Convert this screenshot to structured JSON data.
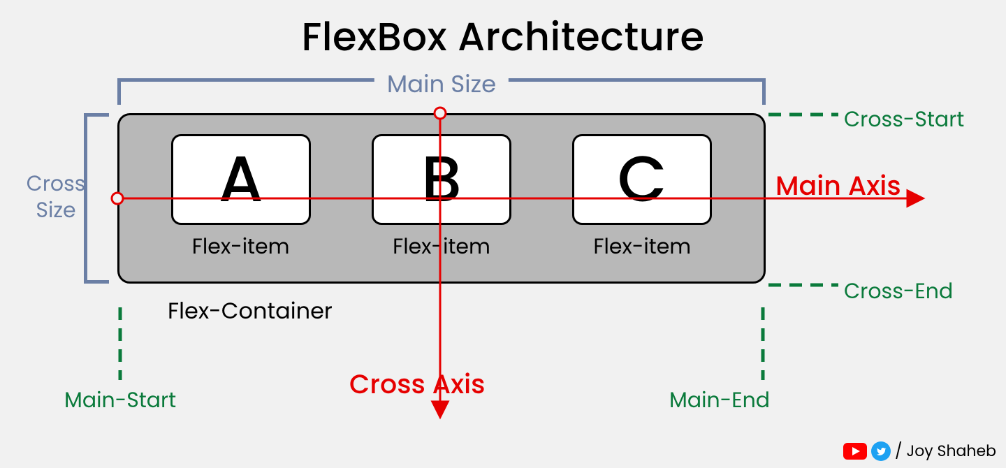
{
  "title": "FlexBox Architecture",
  "mainSizeLabel": "Main Size",
  "crossSizeLabel": "Cross\nSize",
  "items": {
    "a": "A",
    "b": "B",
    "c": "C"
  },
  "flexItemLabel": "Flex-item",
  "containerLabel": "Flex-Container",
  "axis": {
    "mainAxis": "Main Axis",
    "crossAxis": "Cross Axis"
  },
  "edges": {
    "crossStart": "Cross-Start",
    "crossEnd": "Cross-End",
    "mainStart": "Main-Start",
    "mainEnd": "Main-End"
  },
  "credit": {
    "prefix": "/ ",
    "name": "Joy Shaheb"
  },
  "colors": {
    "accentRed": "#e60000",
    "accentBlue": "#6b7fa5",
    "accentGreen": "#0a7a3b",
    "containerFill": "#b8b8b8",
    "pageBg": "#f1f1f1"
  },
  "icons": {
    "youtube": "youtube-icon",
    "twitter": "twitter-icon"
  }
}
